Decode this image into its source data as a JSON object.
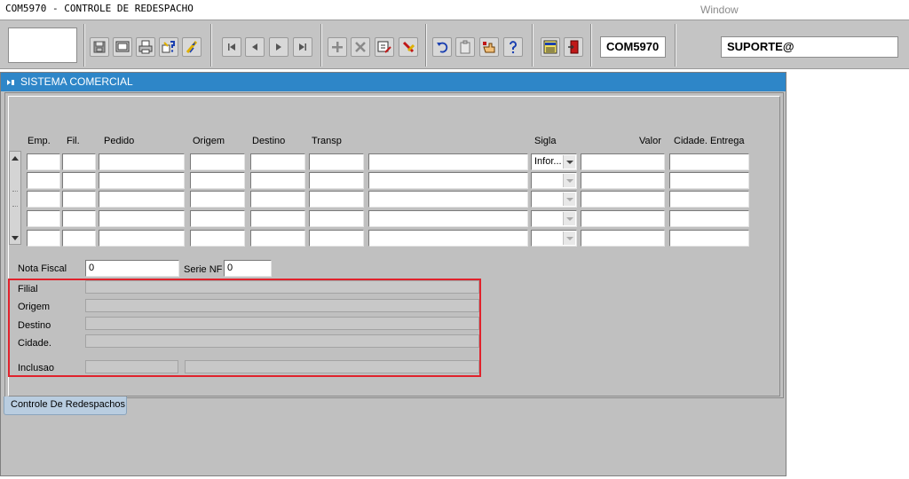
{
  "menubar": {
    "title": "COM5970 - CONTROLE DE REDESPACHO",
    "window_menu": "Window"
  },
  "toolbar": {
    "buttons": [
      {
        "name": "save-icon"
      },
      {
        "name": "print-preview-icon"
      },
      {
        "name": "print-icon"
      },
      {
        "name": "query-help-icon"
      },
      {
        "name": "execute-query-icon"
      },
      {
        "name": "first-record-icon"
      },
      {
        "name": "previous-record-icon"
      },
      {
        "name": "next-record-icon"
      },
      {
        "name": "last-record-icon"
      },
      {
        "name": "insert-record-icon"
      },
      {
        "name": "delete-record-icon"
      },
      {
        "name": "edit-record-icon"
      },
      {
        "name": "clear-record-icon"
      },
      {
        "name": "undo-icon"
      },
      {
        "name": "clipboard-icon"
      },
      {
        "name": "hand-pointer-icon"
      },
      {
        "name": "help-icon"
      },
      {
        "name": "menu-icon"
      },
      {
        "name": "exit-door-icon"
      }
    ],
    "form_code": "COM5970",
    "user": "SUPORTE@"
  },
  "window": {
    "title": "SISTEMA COMERCIAL",
    "title_color": "#2e86c8"
  },
  "grid": {
    "headers": {
      "emp": "Emp.",
      "fil": "Fil.",
      "pedido": "Pedido",
      "origem": "Origem",
      "destino": "Destino",
      "transp": "Transp",
      "sigla": "Sigla",
      "valor": "Valor",
      "cidade_entrega": "Cidade. Entrega"
    },
    "rows": [
      {
        "sigla": "Infor..."
      },
      {
        "sigla": ""
      },
      {
        "sigla": ""
      },
      {
        "sigla": ""
      },
      {
        "sigla": ""
      }
    ]
  },
  "nota": {
    "nota_fiscal_label": "Nota Fiscal",
    "nota_fiscal_value": "0",
    "serie_label": "Serie NF",
    "serie_value": "0"
  },
  "details": {
    "filial_label": "Filial",
    "origem_label": "Origem",
    "destino_label": "Destino",
    "cidade_label": "Cidade.",
    "inclusao_label": "Inclusao",
    "highlight_color": "#e0222c"
  },
  "tab": {
    "label": "Controle De Redespachos"
  }
}
